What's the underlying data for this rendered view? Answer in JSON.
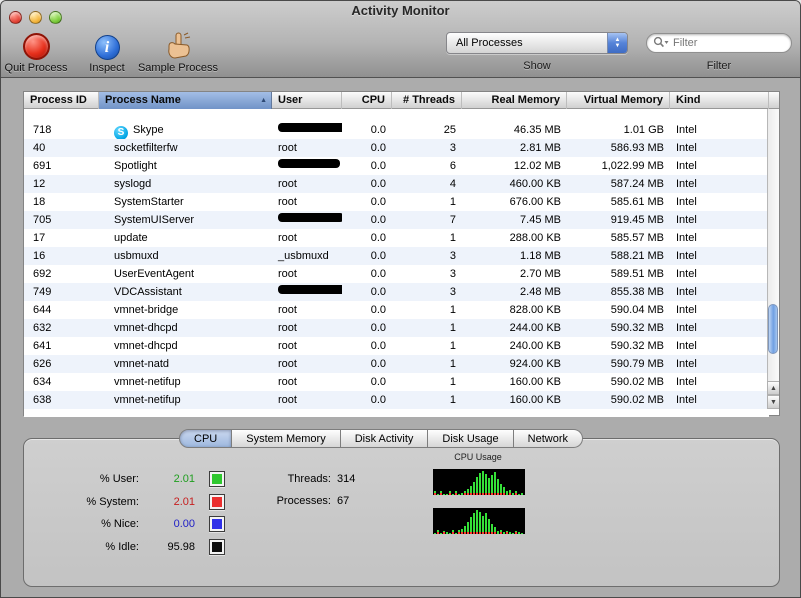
{
  "window": {
    "title": "Activity Monitor"
  },
  "toolbar": {
    "quit_label": "Quit Process",
    "inspect_label": "Inspect",
    "sample_label": "Sample Process",
    "show_label": "Show",
    "show_value": "All Processes",
    "filter_label": "Filter",
    "filter_placeholder": "Filter"
  },
  "table": {
    "columns": [
      "Process ID",
      "Process Name",
      "User",
      "CPU",
      "# Threads",
      "Real Memory",
      "Virtual Memory",
      "Kind"
    ],
    "sort": {
      "column": "Process Name",
      "direction": "ascending"
    },
    "rows": [
      {
        "pid": "718",
        "name": "Skype",
        "icon": "skype",
        "user": "",
        "user_redacted": true,
        "redact_w": 86,
        "cpu": "0.0",
        "threads": "25",
        "real": "46.35 MB",
        "virtual": "1.01 GB",
        "kind": "Intel"
      },
      {
        "pid": "40",
        "name": "socketfilterfw",
        "user": "root",
        "cpu": "0.0",
        "threads": "3",
        "real": "2.81 MB",
        "virtual": "586.93 MB",
        "kind": "Intel"
      },
      {
        "pid": "691",
        "name": "Spotlight",
        "user": "",
        "user_redacted": true,
        "redact_w": 62,
        "cpu": "0.0",
        "threads": "6",
        "real": "12.02 MB",
        "virtual": "1,022.99 MB",
        "kind": "Intel"
      },
      {
        "pid": "12",
        "name": "syslogd",
        "user": "root",
        "cpu": "0.0",
        "threads": "4",
        "real": "460.00 KB",
        "virtual": "587.24 MB",
        "kind": "Intel"
      },
      {
        "pid": "18",
        "name": "SystemStarter",
        "user": "root",
        "cpu": "0.0",
        "threads": "1",
        "real": "676.00 KB",
        "virtual": "585.61 MB",
        "kind": "Intel"
      },
      {
        "pid": "705",
        "name": "SystemUIServer",
        "user": "",
        "user_redacted": true,
        "redact_w": 66,
        "cpu": "0.0",
        "threads": "7",
        "real": "7.45 MB",
        "virtual": "919.45 MB",
        "kind": "Intel"
      },
      {
        "pid": "17",
        "name": "update",
        "user": "root",
        "cpu": "0.0",
        "threads": "1",
        "real": "288.00 KB",
        "virtual": "585.57 MB",
        "kind": "Intel"
      },
      {
        "pid": "16",
        "name": "usbmuxd",
        "user": "_usbmuxd",
        "cpu": "0.0",
        "threads": "3",
        "real": "1.18 MB",
        "virtual": "588.21 MB",
        "kind": "Intel"
      },
      {
        "pid": "692",
        "name": "UserEventAgent",
        "user": "root",
        "cpu": "0.0",
        "threads": "3",
        "real": "2.70 MB",
        "virtual": "589.51 MB",
        "kind": "Intel"
      },
      {
        "pid": "749",
        "name": "VDCAssistant",
        "user": "",
        "user_redacted": true,
        "redact_w": 76,
        "cpu": "0.0",
        "threads": "3",
        "real": "2.48 MB",
        "virtual": "855.38 MB",
        "kind": "Intel"
      },
      {
        "pid": "644",
        "name": "vmnet-bridge",
        "user": "root",
        "cpu": "0.0",
        "threads": "1",
        "real": "828.00 KB",
        "virtual": "590.04 MB",
        "kind": "Intel"
      },
      {
        "pid": "632",
        "name": "vmnet-dhcpd",
        "user": "root",
        "cpu": "0.0",
        "threads": "1",
        "real": "244.00 KB",
        "virtual": "590.32 MB",
        "kind": "Intel"
      },
      {
        "pid": "641",
        "name": "vmnet-dhcpd",
        "user": "root",
        "cpu": "0.0",
        "threads": "1",
        "real": "240.00 KB",
        "virtual": "590.32 MB",
        "kind": "Intel"
      },
      {
        "pid": "626",
        "name": "vmnet-natd",
        "user": "root",
        "cpu": "0.0",
        "threads": "1",
        "real": "924.00 KB",
        "virtual": "590.79 MB",
        "kind": "Intel"
      },
      {
        "pid": "634",
        "name": "vmnet-netifup",
        "user": "root",
        "cpu": "0.0",
        "threads": "1",
        "real": "160.00 KB",
        "virtual": "590.02 MB",
        "kind": "Intel"
      },
      {
        "pid": "638",
        "name": "vmnet-netifup",
        "user": "root",
        "cpu": "0.0",
        "threads": "1",
        "real": "160.00 KB",
        "virtual": "590.02 MB",
        "kind": "Intel"
      }
    ]
  },
  "panel": {
    "tabs": [
      "CPU",
      "System Memory",
      "Disk Activity",
      "Disk Usage",
      "Network"
    ],
    "active_tab": "CPU"
  },
  "cpu": {
    "stats": [
      {
        "name": "user",
        "label": "% User:",
        "value": "2.01",
        "value_color": "#1f9e1f",
        "swatch_color": "#2fc82f"
      },
      {
        "name": "system",
        "label": "% System:",
        "value": "2.01",
        "value_color": "#c61e1e",
        "swatch_color": "#ea2f2f"
      },
      {
        "name": "nice",
        "label": "% Nice:",
        "value": "0.00",
        "value_color": "#2020c6",
        "swatch_color": "#3030e8"
      },
      {
        "name": "idle",
        "label": "% Idle:",
        "value": "95.98",
        "value_color": "#000000",
        "swatch_color": "#0d0d0d"
      }
    ],
    "threads_label": "Threads:",
    "threads_value": "314",
    "processes_label": "Processes:",
    "processes_value": "67",
    "graph_title": "CPU Usage",
    "graphs": [
      {
        "green": [
          2,
          1,
          2,
          1,
          1,
          2,
          1,
          2,
          1,
          2,
          2,
          4,
          7,
          11,
          16,
          20,
          22,
          19,
          15,
          18,
          21,
          14,
          9,
          6,
          4,
          3,
          2,
          2,
          1,
          2
        ],
        "red": [
          1,
          0,
          1,
          0,
          0,
          1,
          0,
          1,
          0,
          0,
          1,
          1,
          1,
          1,
          1,
          1,
          1,
          1,
          1,
          1,
          1,
          1,
          1,
          1,
          0,
          1,
          0,
          1,
          0,
          0
        ]
      },
      {
        "green": [
          1,
          2,
          1,
          1,
          2,
          1,
          2,
          1,
          2,
          3,
          6,
          10,
          15,
          19,
          22,
          20,
          16,
          19,
          13,
          8,
          5,
          3,
          2,
          2,
          1,
          2,
          1,
          1,
          2,
          1
        ],
        "red": [
          0,
          1,
          0,
          1,
          0,
          0,
          1,
          0,
          1,
          1,
          1,
          1,
          1,
          1,
          1,
          1,
          1,
          1,
          1,
          1,
          1,
          0,
          1,
          0,
          1,
          0,
          0,
          1,
          0,
          0
        ]
      }
    ]
  }
}
